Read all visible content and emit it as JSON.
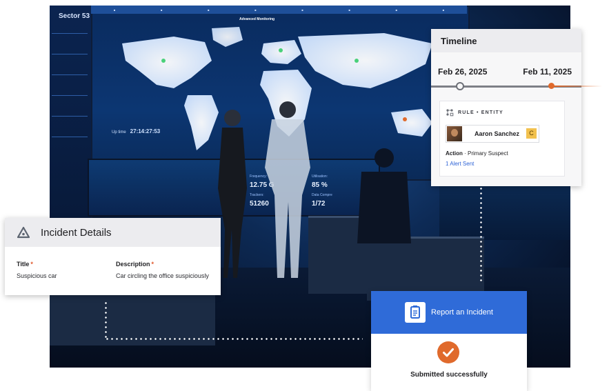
{
  "background": {
    "sector_title": "Sector 53",
    "screen_header": "Advanced Monitoring",
    "uptime_label": "Up time",
    "uptime_value": "27:14:27:53",
    "stats": [
      {
        "label": "Frequency:",
        "value": "12.75 G"
      },
      {
        "label": "Utilisation:",
        "value": "85 %"
      },
      {
        "label": "Trackers:",
        "value": "51260"
      },
      {
        "label": "Data Compre",
        "value": "1/72"
      }
    ]
  },
  "timeline": {
    "title": "Timeline",
    "start_date": "Feb 26, 2025",
    "end_date": "Feb 11, 2025",
    "rule_label": "RULE • ENTITY",
    "entity_name": "Aaron Sanchez",
    "entity_tag": "C",
    "action_label": "Action",
    "action_value": " · Primary Suspect",
    "alert_link": "1 Alert Sent"
  },
  "incident": {
    "title": "Incident Details",
    "fields": [
      {
        "label": "Title",
        "required": "*",
        "value": "Suspicious car"
      },
      {
        "label": "Description",
        "required": "*",
        "value": "Car circling the office suspiciously"
      }
    ]
  },
  "report": {
    "title": "Report an Incident",
    "status": "Submitted successfully"
  },
  "colors": {
    "accent_orange": "#e06a2c",
    "accent_blue": "#2f6bd8",
    "link_blue": "#2e63d6",
    "tag_yellow": "#f2c14e"
  }
}
